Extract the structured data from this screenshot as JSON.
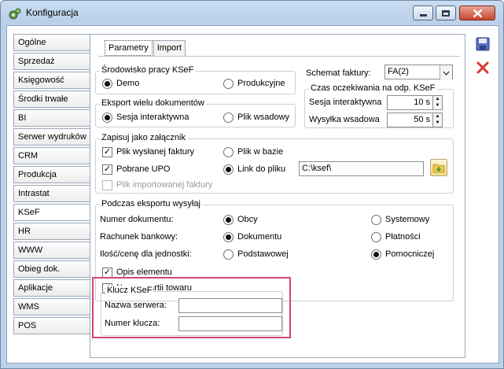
{
  "window": {
    "title": "Konfiguracja",
    "controls": [
      "minimize",
      "maximize",
      "close"
    ]
  },
  "sidebar": {
    "items": [
      {
        "label": "Ogólne"
      },
      {
        "label": "Sprzedaż"
      },
      {
        "label": "Księgowość"
      },
      {
        "label": "Środki trwałe"
      },
      {
        "label": "BI"
      },
      {
        "label": "Serwer wydruków"
      },
      {
        "label": "CRM"
      },
      {
        "label": "Produkcja"
      },
      {
        "label": "Intrastat"
      },
      {
        "label": "KSeF"
      },
      {
        "label": "HR"
      },
      {
        "label": "WWW"
      },
      {
        "label": "Obieg dok."
      },
      {
        "label": "Aplikacje"
      },
      {
        "label": "WMS"
      },
      {
        "label": "POS"
      }
    ],
    "active": "KSeF"
  },
  "tabs": [
    {
      "label": "Parametry"
    },
    {
      "label": "Import"
    }
  ],
  "env": {
    "title": "Środowisko pracy KSeF",
    "demo": "Demo",
    "prod": "Produkcyjne",
    "selected": "Demo"
  },
  "schema": {
    "label": "Schemat faktury:",
    "value": "FA(2)"
  },
  "export_multi": {
    "title": "Eksport wielu dokumentów",
    "option1": "Sesja interaktywna",
    "option2": "Plik wsadowy",
    "selected": "Sesja interaktywna"
  },
  "timeout": {
    "title": "Czas oczekiwania na odp. KSeF",
    "interactive_label": "Sesja interaktywna",
    "interactive_value": "10 s",
    "batch_label": "Wysyłka wsadowa",
    "batch_value": "50 s"
  },
  "attachment": {
    "title": "Zapisuj jako załącznik",
    "sent_invoice": "Plik wysłanej faktury",
    "upo": "Pobrane UPO",
    "imported_invoice": "Plik importowanej faktury",
    "file_in_db": "Plik w bazie",
    "file_link": "Link do pliku",
    "path": "C:\\ksef\\"
  },
  "export_send": {
    "title": "Podczas eksportu wysyłaj",
    "doc_number_label": "Numer dokumentu:",
    "doc_number_opt1": "Obcy",
    "doc_number_opt2": "Systemowy",
    "bank_label": "Rachunek bankowy:",
    "bank_opt1": "Dokumentu",
    "bank_opt2": "Płatności",
    "qty_label": "Ilość/cenę dla jednostki:",
    "qty_opt1": "Podstawowej",
    "qty_opt2": "Pomocniczej",
    "element_desc": "Opis elementu",
    "batch_number": "Numer partii towaru"
  },
  "ksef_key": {
    "title": "Klucz KSeF",
    "server_label": "Nazwa serwera:",
    "server_value": "",
    "key_label": "Numer klucza:",
    "key_value": ""
  },
  "colors": {
    "highlight": "#d2476e",
    "close_red": "#c6452f",
    "save_blue": "#5a6fc2"
  }
}
